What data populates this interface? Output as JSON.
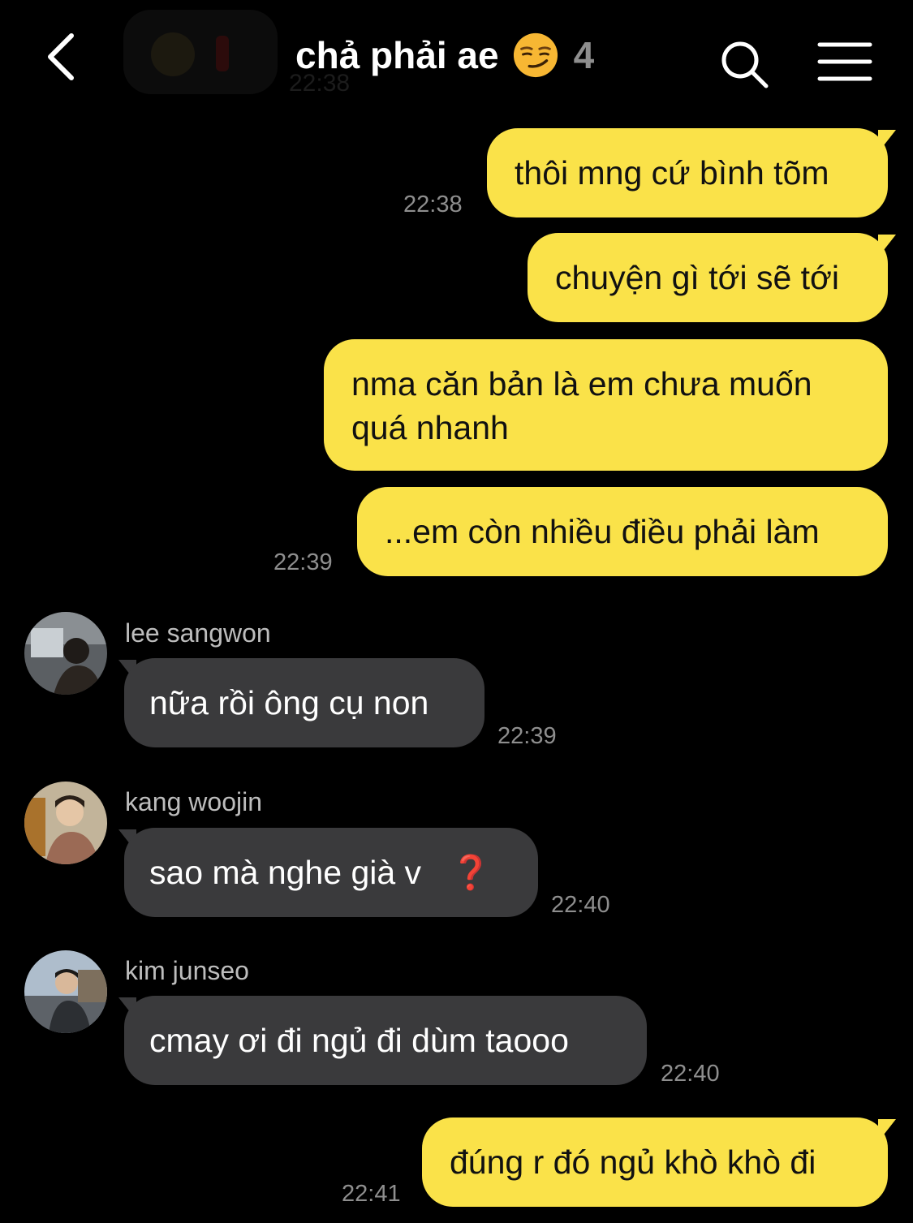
{
  "header": {
    "faded_time": "22:38",
    "title": "chả phải ae",
    "member_count": "4",
    "back_icon": "chevron-left-icon",
    "search_icon": "search-icon",
    "menu_icon": "hamburger-menu-icon"
  },
  "messages": [
    {
      "text": "thôi mng cứ bình tõm"
    },
    {
      "text": "chuyện gì tới sẽ tới"
    },
    {
      "line1": "nma căn bản là em chưa muốn",
      "line2": "quá nhanh"
    },
    {
      "text": "...em còn nhiều điều phải làm"
    },
    {
      "sender": "lee sangwon",
      "text": "nữa rồi ông cụ non",
      "time": "22:39"
    },
    {
      "sender": "kang woojin",
      "text": "sao mà nghe già v",
      "emoji": "❓",
      "time": "22:40"
    },
    {
      "sender": "kim junseo",
      "text": "cmay ơi đi ngủ đi dùm taooo",
      "time": "22:40"
    },
    {
      "text": "đúng r đó ngủ khò khò đi"
    }
  ],
  "times": {
    "t1": "22:38",
    "t2": "22:39",
    "t3": "22:41"
  },
  "colors": {
    "background": "#000000",
    "my_bubble": "#fae249",
    "their_bubble": "#3a3a3c",
    "timestamp": "#8e8e8e"
  }
}
